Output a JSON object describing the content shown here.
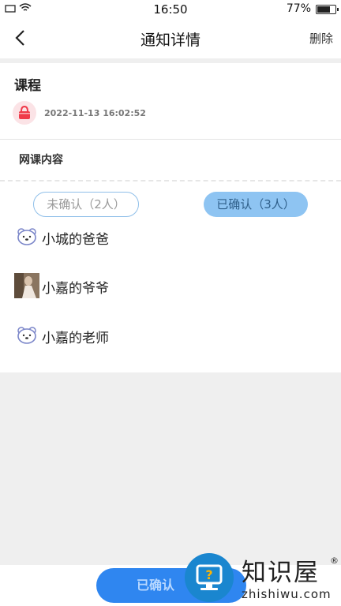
{
  "status_bar": {
    "time": "16:50",
    "battery": "77%",
    "battery_level": 0.77
  },
  "nav": {
    "title": "通知详情",
    "delete_label": "删除",
    "back_icon": "chevron-left-icon"
  },
  "notice": {
    "title": "课程",
    "timestamp": "2022-11-13 16:02:52",
    "content": "网课内容",
    "avatar_icon": "shopping-basket-icon"
  },
  "tabs": {
    "unconfirmed": "未确认（2人）",
    "confirmed": "已确认（3人）",
    "active": "confirmed"
  },
  "confirmed_people": [
    {
      "name": "小城的爸爸",
      "avatar": "bear-face-icon"
    },
    {
      "name": "小嘉的爷爷",
      "avatar": "photo-avatar"
    },
    {
      "name": "小嘉的老师",
      "avatar": "bear-face-icon"
    }
  ],
  "footer": {
    "button_label": "已确认"
  },
  "watermark": {
    "brand": "知识屋",
    "registered": "®",
    "url": "zhishiwu.com"
  },
  "colors": {
    "accent": "#2f86f0",
    "tab_active_bg": "#8ec4f2",
    "page_bg": "#efefef"
  }
}
